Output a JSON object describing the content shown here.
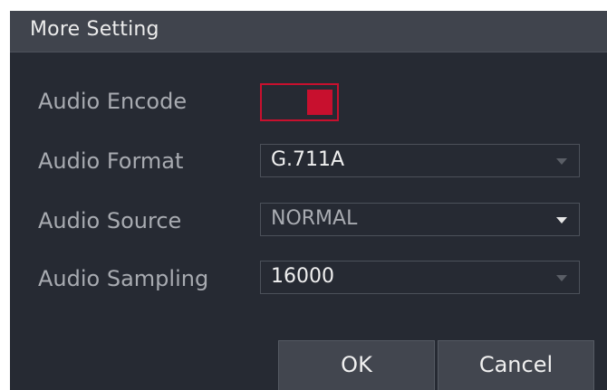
{
  "dialog": {
    "title": "More Setting"
  },
  "fields": {
    "audio_encode": {
      "label": "Audio Encode",
      "enabled": true
    },
    "audio_format": {
      "label": "Audio Format",
      "value": "G.711A",
      "state": "enabled"
    },
    "audio_source": {
      "label": "Audio Source",
      "value": "NORMAL",
      "state": "disabled"
    },
    "audio_sampling": {
      "label": "Audio Sampling",
      "value": "16000",
      "state": "enabled"
    }
  },
  "buttons": {
    "ok_label": "OK",
    "cancel_label": "Cancel"
  },
  "colors": {
    "dialog_bg": "#262a33",
    "titlebar_bg": "#40444d",
    "accent_red": "#c8102e",
    "button_bg": "#42464f"
  },
  "icons": {
    "dropdown": "chevron-down-icon"
  }
}
